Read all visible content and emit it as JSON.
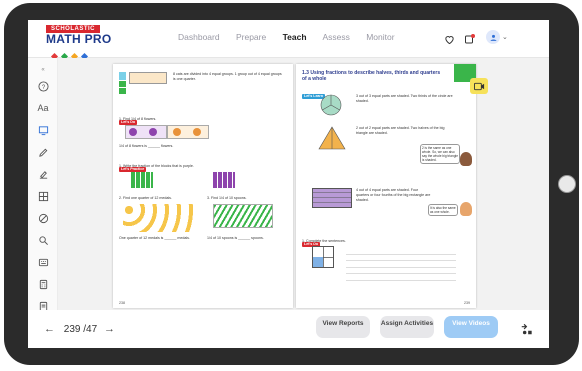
{
  "brand": {
    "top": "SCHOLASTIC",
    "main": "MATH PRO",
    "colors": [
      "#e23b3b",
      "#2aa84a",
      "#f5a623",
      "#2f6fd6"
    ]
  },
  "nav": {
    "items": [
      "Dashboard",
      "Prepare",
      "Teach",
      "Assess",
      "Monitor"
    ],
    "active": "Teach"
  },
  "top_icons": [
    "heart-icon",
    "notifications-icon",
    "user-avatar-icon",
    "chevron-down-icon"
  ],
  "sidebar": {
    "items": [
      "help-icon",
      "text-size-icon",
      "screen-icon",
      "pen-icon",
      "highlighter-icon",
      "table-icon",
      "eraser-icon",
      "zoom-icon",
      "keyboard-icon",
      "calculator-icon",
      "document-icon"
    ],
    "text_size_label": "Aa"
  },
  "left_page": {
    "tag_learn": "Let's Do",
    "tag_practice": "Let's Practice",
    "q1": "1. Find 1/4 of 8 flowers.",
    "q1_answer": "1/4 of 8 flowers is ______ flowers.",
    "q_write": "1. Write the fraction of the blocks that is purple.",
    "q2": "2. Find one quarter of 12 medals.",
    "q2_answer": "One quarter of 12 medals is ______ medals.",
    "q3": "3. Find 1/4 of 10 spoons.",
    "q3_answer": "1/4 of 10 spoons is ______ spoons.",
    "intro_text": "8 cats are divided into 4 equal groups. 1 group out of 4 equal groups is one quarter.",
    "page_number": "238"
  },
  "right_page": {
    "title": "1.3 Using fractions to describe halves, thirds and quarters of a whole",
    "tag": "Let's Learn",
    "section_a": "3 out of 3 equal parts are shaded. Two thirds of the circle are shaded.",
    "section_b": "2 out of 2 equal parts are shaded. Two halves of the big triangle are shaded.",
    "section_c": "4 out of 4 equal parts are shaded. Four quarters or four fourths of the big rectangle are shaded.",
    "speech_1": "2 is the same as one whole. So, we can also say the whole big triangle is shaded.",
    "speech_2": "It is also the same as one whole.",
    "tag_do": "Let's Do",
    "complete": "1. Complete the sentences.",
    "page_number": "239"
  },
  "bottom": {
    "page_current": "239",
    "page_total": "/47",
    "buttons": [
      "View Reports",
      "Assign Activities",
      "View Videos"
    ]
  }
}
